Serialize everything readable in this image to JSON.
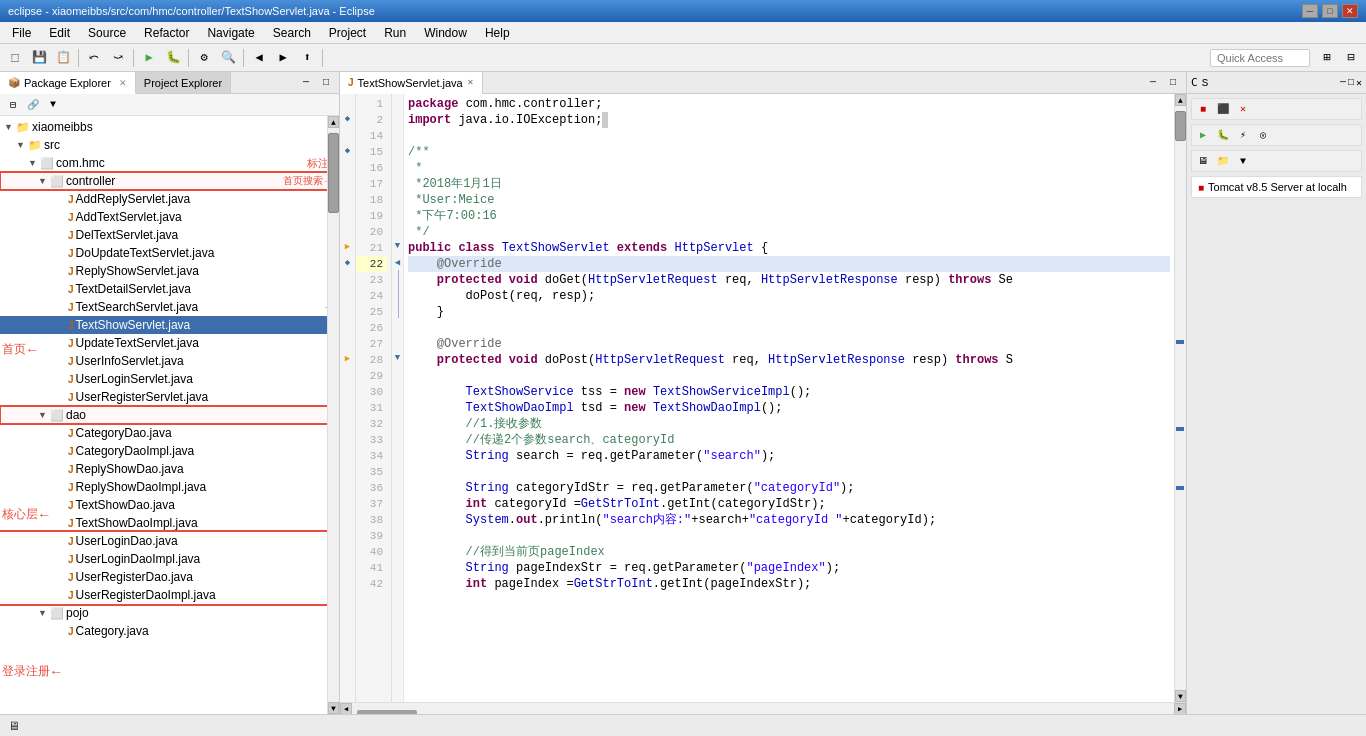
{
  "titlebar": {
    "title": "eclipse - xiaomeibbs/src/com/hmc/controller/TextShowServlet.java - Eclipse",
    "minimize": "─",
    "maximize": "□",
    "close": "✕"
  },
  "menubar": {
    "items": [
      "File",
      "Edit",
      "Source",
      "Refactor",
      "Navigate",
      "Search",
      "Project",
      "Run",
      "Window",
      "Help"
    ]
  },
  "toolbar": {
    "quick_access_placeholder": "Quick Access"
  },
  "left_panel": {
    "tabs": [
      {
        "label": "Package Explorer",
        "active": true
      },
      {
        "label": "Project Explorer",
        "active": false
      }
    ],
    "tree": {
      "root": "xiaomeibbs",
      "items": [
        {
          "indent": 0,
          "label": "xiaomeibbs",
          "icon": "📁",
          "arrow": "▼",
          "type": "project"
        },
        {
          "indent": 1,
          "label": "src",
          "icon": "📁",
          "arrow": "▼",
          "type": "folder"
        },
        {
          "indent": 2,
          "label": "com.hmc",
          "icon": "📦",
          "arrow": "▼",
          "type": "package"
        },
        {
          "indent": 3,
          "label": "controller",
          "icon": "📦",
          "arrow": "▼",
          "type": "package",
          "boxed": true
        },
        {
          "indent": 4,
          "label": "AddReplyServlet.java",
          "icon": "J",
          "arrow": "",
          "type": "java"
        },
        {
          "indent": 4,
          "label": "AddTextServlet.java",
          "icon": "J",
          "arrow": "",
          "type": "java"
        },
        {
          "indent": 4,
          "label": "DelTextServlet.java",
          "icon": "J",
          "arrow": "",
          "type": "java"
        },
        {
          "indent": 4,
          "label": "DoUpdateTextServlet.java",
          "icon": "J",
          "arrow": "",
          "type": "java"
        },
        {
          "indent": 4,
          "label": "ReplyShowServlet.java",
          "icon": "J",
          "arrow": "",
          "type": "java"
        },
        {
          "indent": 4,
          "label": "TextDetailServlet.java",
          "icon": "J",
          "arrow": "",
          "type": "java"
        },
        {
          "indent": 4,
          "label": "TextSearchServlet.java",
          "icon": "J",
          "arrow": "",
          "type": "java",
          "annotated": true
        },
        {
          "indent": 4,
          "label": "TextShowServlet.java",
          "icon": "J",
          "arrow": "",
          "type": "java",
          "selected": true
        },
        {
          "indent": 4,
          "label": "UpdateTextServlet.java",
          "icon": "J",
          "arrow": "",
          "type": "java"
        },
        {
          "indent": 4,
          "label": "UserInfoServlet.java",
          "icon": "J",
          "arrow": "",
          "type": "java"
        },
        {
          "indent": 4,
          "label": "UserLoginServlet.java",
          "icon": "J",
          "arrow": "",
          "type": "java"
        },
        {
          "indent": 4,
          "label": "UserRegisterServlet.java",
          "icon": "J",
          "arrow": "",
          "type": "java"
        },
        {
          "indent": 3,
          "label": "dao",
          "icon": "📦",
          "arrow": "▼",
          "type": "package",
          "boxed": true
        },
        {
          "indent": 4,
          "label": "CategoryDao.java",
          "icon": "J",
          "arrow": "",
          "type": "java"
        },
        {
          "indent": 4,
          "label": "CategoryDaoImpl.java",
          "icon": "J",
          "arrow": "",
          "type": "java"
        },
        {
          "indent": 4,
          "label": "ReplyShowDao.java",
          "icon": "J",
          "arrow": "",
          "type": "java"
        },
        {
          "indent": 4,
          "label": "ReplyShowDaoImpl.java",
          "icon": "J",
          "arrow": "",
          "type": "java"
        },
        {
          "indent": 4,
          "label": "TextShowDao.java",
          "icon": "J",
          "arrow": "",
          "type": "java"
        },
        {
          "indent": 4,
          "label": "TextShowDaoImpl.java",
          "icon": "J",
          "arrow": "",
          "type": "java"
        },
        {
          "indent": 4,
          "label": "UserLoginDao.java",
          "icon": "J",
          "arrow": "",
          "type": "java",
          "boxed_group": true
        },
        {
          "indent": 4,
          "label": "UserLoginDaoImpl.java",
          "icon": "J",
          "arrow": "",
          "type": "java",
          "boxed_group": true
        },
        {
          "indent": 4,
          "label": "UserRegisterDao.java",
          "icon": "J",
          "arrow": "",
          "type": "java",
          "boxed_group": true
        },
        {
          "indent": 4,
          "label": "UserRegisterDaoImpl.java",
          "icon": "J",
          "arrow": "",
          "type": "java",
          "boxed_group": true
        },
        {
          "indent": 3,
          "label": "pojo",
          "icon": "📦",
          "arrow": "▼",
          "type": "package"
        },
        {
          "indent": 4,
          "label": "Category.java",
          "icon": "J",
          "arrow": "",
          "type": "java"
        }
      ]
    }
  },
  "annotations": {
    "shouye": "首页",
    "shouyesousuo": "首页搜索",
    "biaozhu": "标注",
    "hexinceng": "核心层",
    "dengluceng": "登录注册"
  },
  "code_panel": {
    "tab_label": "TextShowServlet.java",
    "lines": [
      {
        "num": 1,
        "content": "package com.hmc.controller;"
      },
      {
        "num": 2,
        "content": "import java.io.IOException;□",
        "marker": "*"
      },
      {
        "num": 14,
        "content": ""
      },
      {
        "num": 15,
        "content": "/**",
        "marker": "*"
      },
      {
        "num": 16,
        "content": " *"
      },
      {
        "num": 17,
        "content": " *2018年1月1日"
      },
      {
        "num": 18,
        "content": " *User:Meice"
      },
      {
        "num": 19,
        "content": " *下午7:00:16"
      },
      {
        "num": 20,
        "content": " */"
      },
      {
        "num": 21,
        "content": "public class TextShowServlet extends HttpServlet {"
      },
      {
        "num": 22,
        "content": "    @Override",
        "marker": "*"
      },
      {
        "num": 23,
        "content": "    protected void doGet(HttpServletRequest req, HttpServletResponse resp) throws Se"
      },
      {
        "num": 24,
        "content": "        doPost(req, resp);"
      },
      {
        "num": 25,
        "content": "    }"
      },
      {
        "num": 26,
        "content": ""
      },
      {
        "num": 27,
        "content": "    @Override"
      },
      {
        "num": 28,
        "content": "    protected void doPost(HttpServletRequest req, HttpServletResponse resp) throws S"
      },
      {
        "num": 29,
        "content": ""
      },
      {
        "num": 30,
        "content": "        TextShowService tss = new TextShowServiceImpl();"
      },
      {
        "num": 31,
        "content": "        TextShowDaoImpl tsd = new TextShowDaoImpl();"
      },
      {
        "num": 32,
        "content": "        //1.接收参数"
      },
      {
        "num": 33,
        "content": "        //传递2个参数search、categoryId"
      },
      {
        "num": 34,
        "content": "        String search = req.getParameter(\"search\");"
      },
      {
        "num": 35,
        "content": ""
      },
      {
        "num": 36,
        "content": "        String categoryIdStr = req.getParameter(\"categoryId\");"
      },
      {
        "num": 37,
        "content": "        int categoryId = GetStrToInt.getInt(categoryIdStr);"
      },
      {
        "num": 38,
        "content": "        System.out.println(\"search内容:\"+search+\"categoryId \"+categoryId);"
      },
      {
        "num": 39,
        "content": ""
      },
      {
        "num": 40,
        "content": "        //得到当前页pageIndex"
      },
      {
        "num": 41,
        "content": "        String pageIndexStr = req.getParameter(\"pageIndex\");"
      },
      {
        "num": 42,
        "content": "        int pageIndex = GetStrToInt.getInt(pageIndexStr);"
      }
    ]
  },
  "right_panel": {
    "tabs": [
      "C",
      "S",
      "☰",
      "□"
    ],
    "server": "Tomcat v8.5 Server at localh"
  },
  "statusbar": {
    "text": ""
  }
}
